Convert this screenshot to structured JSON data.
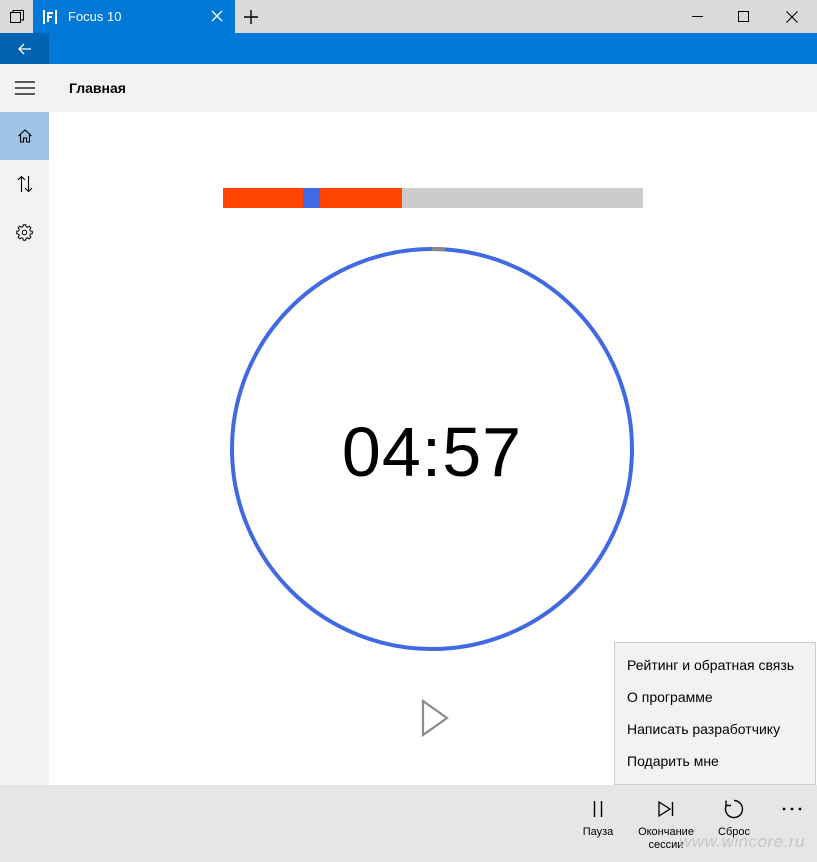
{
  "window": {
    "tab_title": "Focus 10",
    "icons": [
      "sets-icon",
      "app-logo-icon",
      "close-tab-icon",
      "new-tab-icon",
      "minimize-icon",
      "maximize-icon",
      "close-window-icon"
    ]
  },
  "header": {
    "title": "Главная"
  },
  "nav": {
    "items": [
      {
        "name": "home",
        "icon": "home-icon",
        "active": true
      },
      {
        "name": "sort",
        "icon": "sort-arrows-icon",
        "active": false
      },
      {
        "name": "settings",
        "icon": "gear-icon",
        "active": false
      }
    ]
  },
  "session": {
    "colors": {
      "work": "#ff4500",
      "break": "#4169e1",
      "remaining": "#cccccc"
    },
    "progress_fraction": 0.426,
    "segments": [
      {
        "type": "work",
        "fraction": 0.19
      },
      {
        "type": "break",
        "fraction": 0.04
      },
      {
        "type": "work",
        "fraction": 0.196
      }
    ]
  },
  "timer": {
    "time": "04:57",
    "progress_fraction": 0.01,
    "ring_color": "#4169e1",
    "elapsed_color": "#888888"
  },
  "context_menu": {
    "items": [
      {
        "label": "Рейтинг и обратная связь"
      },
      {
        "label": "О программе"
      },
      {
        "label": "Написать разработчику"
      },
      {
        "label": "Подарить мне"
      }
    ]
  },
  "commands": {
    "pause": "Пауза",
    "end_session_line1": "Окончание",
    "end_session_line2": "сессии",
    "reset": "Сброс"
  },
  "watermark": "www.wincore.ru"
}
